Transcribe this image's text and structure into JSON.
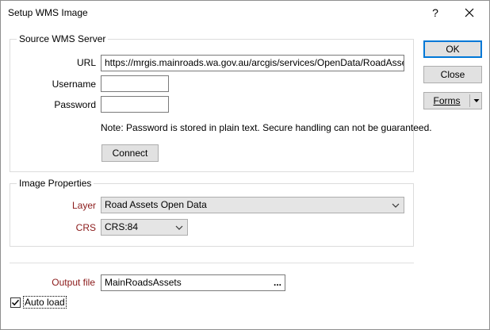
{
  "window": {
    "title": "Setup WMS Image",
    "help_label": "?"
  },
  "source_group": {
    "legend": "Source WMS Server",
    "url_label": "URL",
    "url_value": "https://mrgis.mainroads.wa.gov.au/arcgis/services/OpenData/RoadAssets_DataPortal",
    "username_label": "Username",
    "username_value": "",
    "password_label": "Password",
    "password_value": "",
    "note": "Note: Password is stored in plain text. Secure handling can not be guaranteed.",
    "connect_label": "Connect"
  },
  "image_group": {
    "legend": "Image Properties",
    "layer_label": "Layer",
    "layer_value": "Road Assets Open Data",
    "crs_label": "CRS",
    "crs_value": "CRS:84"
  },
  "output": {
    "label": "Output file",
    "value": "MainRoadsAssets",
    "browse_label": "..."
  },
  "auto_load": {
    "label": "Auto load",
    "checked": true
  },
  "buttons": {
    "ok_label": "OK",
    "close_label": "Close",
    "forms_label": "Forms"
  },
  "colors": {
    "required_label": "#8b1a1a",
    "default_button_border": "#0078d7"
  }
}
